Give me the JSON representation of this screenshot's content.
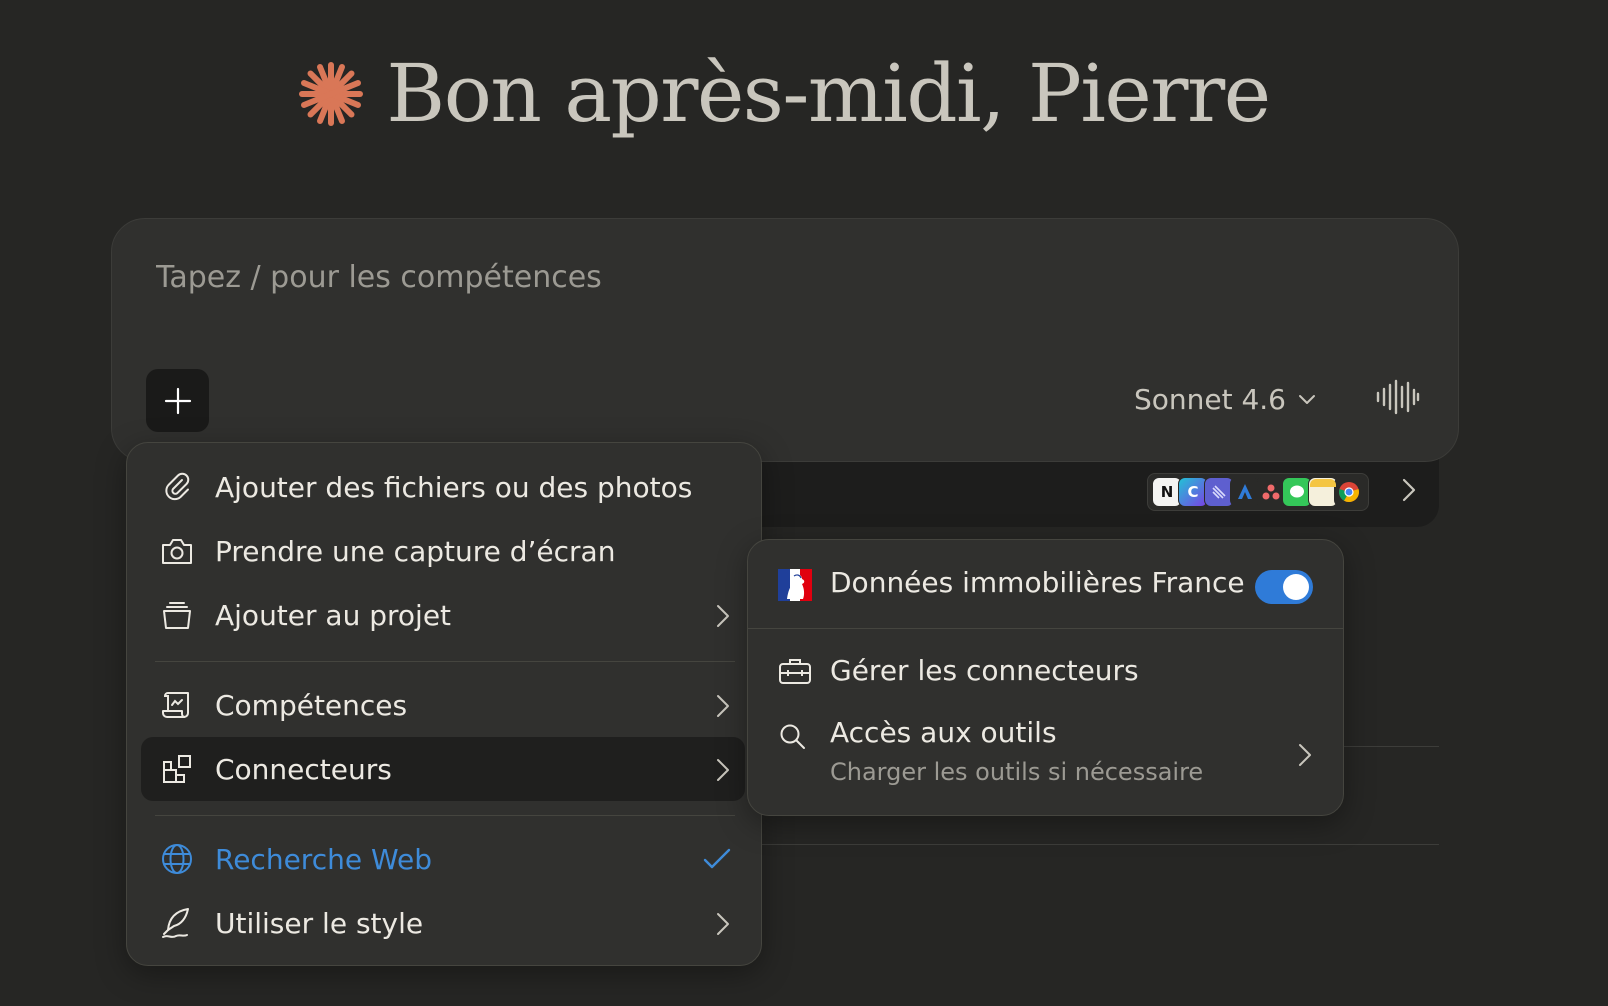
{
  "greeting": {
    "text": "Bon après-midi, Pierre",
    "icon": "sparkle-icon",
    "icon_color": "#d97757"
  },
  "composer": {
    "placeholder": "Tapez / pour les compétences",
    "model_label": "Sonnet 4.6",
    "add_icon": "plus-icon",
    "voice_icon": "waveform-icon"
  },
  "connector_tray": {
    "icons": [
      "notion-icon",
      "canva-icon",
      "linear-icon",
      "atlassian-icon",
      "asana-icon",
      "messages-icon",
      "notes-icon",
      "chrome-icon"
    ]
  },
  "menu": {
    "items": [
      {
        "label": "Ajouter des fichiers ou des photos",
        "icon": "paperclip-icon"
      },
      {
        "label": "Prendre une capture d’écran",
        "icon": "camera-icon"
      },
      {
        "label": "Ajouter au projet",
        "icon": "project-box-icon"
      },
      {
        "label": "Compétences",
        "icon": "scroll-icon"
      },
      {
        "label": "Connecteurs",
        "icon": "connectors-icon"
      },
      {
        "label": "Recherche Web",
        "icon": "globe-icon",
        "checked": true
      },
      {
        "label": "Utiliser le style",
        "icon": "quill-icon"
      }
    ],
    "accent_color": "#3e8bd9"
  },
  "submenu": {
    "connector": {
      "label": "Données immobilières France",
      "icon": "marianne-icon",
      "enabled": true
    },
    "manage_label": "Gérer les connecteurs",
    "tools_label": "Accès aux outils",
    "tools_desc": "Charger les outils si nécessaire",
    "toggle_color": "#2f7bd8"
  }
}
